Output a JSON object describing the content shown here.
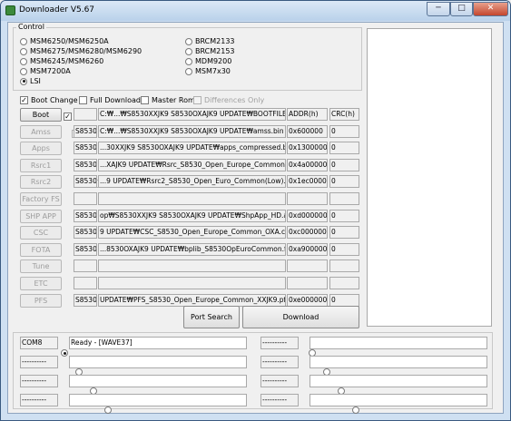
{
  "window": {
    "title": "Downloader V5.67",
    "min": "─",
    "max": "□",
    "close": "✕"
  },
  "control": {
    "label": "Control",
    "radios_left": [
      {
        "label": "MSM6250/MSM6250A",
        "selected": false
      },
      {
        "label": "MSM6275/MSM6280/MSM6290",
        "selected": false
      },
      {
        "label": "MSM6245/MSM6260",
        "selected": false
      },
      {
        "label": "MSM7200A",
        "selected": false
      },
      {
        "label": "LSI",
        "selected": true
      }
    ],
    "radios_right": [
      {
        "label": "BRCM2133",
        "selected": false
      },
      {
        "label": "BRCM2153",
        "selected": false
      },
      {
        "label": "MDM9200",
        "selected": false
      },
      {
        "label": "MSM7x30",
        "selected": false
      }
    ]
  },
  "options": {
    "boot_change": "Boot Change",
    "full_download": "Full Download",
    "master_rom": "Master Rom",
    "differences_only": "Differences Only"
  },
  "rows": [
    {
      "button": "Boot",
      "enabled": true,
      "checked": true,
      "tag": "",
      "path": "C:₩...₩S8530XXJK9 S8530OXAJK9 UPDATE₩BOOTFILES",
      "addr": "ADDR(h)",
      "crc": "CRC(h)"
    },
    {
      "button": "Amss",
      "enabled": false,
      "checked": true,
      "tag": "S8530",
      "path": "C:₩...₩S8530XXJK9 S8530OXAJK9 UPDATE₩amss.bin",
      "addr": "0x600000",
      "crc": "0"
    },
    {
      "button": "Apps",
      "enabled": false,
      "checked": true,
      "tag": "S8530",
      "path": "...30XXJK9 S8530OXAJK9 UPDATE₩apps_compressed.bin",
      "addr": "0x1300000",
      "crc": "0"
    },
    {
      "button": "Rsrc1",
      "enabled": false,
      "checked": true,
      "tag": "S8530",
      "path": "...XAJK9 UPDATE₩Rsrc_S8530_Open_Europe_Common.rc1",
      "addr": "0x4a00000",
      "crc": "0"
    },
    {
      "button": "Rsrc2",
      "enabled": false,
      "checked": true,
      "tag": "S8530",
      "path": "...9 UPDATE₩Rsrc2_S8530_Open_Euro_Common(Low).rc2",
      "addr": "0x1ec00000",
      "crc": "0"
    },
    {
      "button": "Factory FS",
      "enabled": false,
      "checked": false,
      "tag": "",
      "path": "",
      "addr": "",
      "crc": ""
    },
    {
      "button": "SHP APP",
      "enabled": false,
      "checked": true,
      "tag": "S8530",
      "path": "op₩S8530XXJK9 S8530OXAJK9 UPDATE₩ShpApp_HD.app",
      "addr": "0xd0000000",
      "crc": "0"
    },
    {
      "button": "CSC",
      "enabled": false,
      "checked": true,
      "tag": "S8530",
      "path": "9 UPDATE₩CSC_S8530_Open_Europe_Common_OXA.csc",
      "addr": "0xc0000000",
      "crc": "0"
    },
    {
      "button": "FOTA",
      "enabled": false,
      "checked": true,
      "tag": "S8530",
      "path": "...8530OXAJK9 UPDATE₩bplib_S8530OpEuroCommon.fota",
      "addr": "0xa900000",
      "crc": "0"
    },
    {
      "button": "Tune",
      "enabled": false,
      "checked": false,
      "tag": "",
      "path": "",
      "addr": "",
      "crc": ""
    },
    {
      "button": "ETC",
      "enabled": false,
      "checked": false,
      "tag": "",
      "path": "",
      "addr": "",
      "crc": ""
    },
    {
      "button": "PFS",
      "enabled": false,
      "checked": true,
      "tag": "S8530",
      "path": "UPDATE₩PFS_S8530_Open_Europe_Common_XXJK9.pfs",
      "addr": "0xe0000000",
      "crc": "0"
    }
  ],
  "actions": {
    "port_search": "Port Search",
    "download": "Download"
  },
  "ports": [
    {
      "port": "COM8",
      "status": "Ready - [WAVE37]",
      "selected": true
    },
    {
      "port": "----------",
      "status": "",
      "selected": false
    },
    {
      "port": "----------",
      "status": "",
      "selected": false
    },
    {
      "port": "----------",
      "status": "",
      "selected": false
    },
    {
      "port": "----------",
      "status": "",
      "selected": false
    },
    {
      "port": "----------",
      "status": "",
      "selected": false
    },
    {
      "port": "----------",
      "status": "",
      "selected": false
    },
    {
      "port": "----------",
      "status": "",
      "selected": false
    }
  ]
}
